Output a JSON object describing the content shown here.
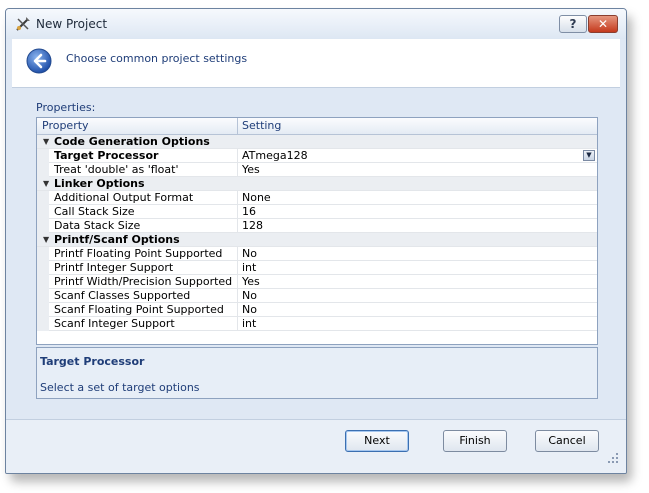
{
  "window": {
    "title": "New Project",
    "help_label": "?",
    "close_label": "✕"
  },
  "header": {
    "subtitle": "Choose common project settings"
  },
  "properties_label": "Properties:",
  "grid": {
    "columns": {
      "property": "Property",
      "setting": "Setting"
    },
    "categories": [
      {
        "label": "Code Generation Options",
        "rows": [
          {
            "name": "Target Processor",
            "value": "ATmega128"
          },
          {
            "name": "Treat 'double' as 'float'",
            "value": "Yes"
          }
        ]
      },
      {
        "label": "Linker Options",
        "rows": [
          {
            "name": "Additional Output Format",
            "value": "None"
          },
          {
            "name": "Call Stack Size",
            "value": "16"
          },
          {
            "name": "Data Stack Size",
            "value": "128"
          }
        ]
      },
      {
        "label": "Printf/Scanf Options",
        "rows": [
          {
            "name": "Printf Floating Point Supported",
            "value": "No"
          },
          {
            "name": "Printf Integer Support",
            "value": "int"
          },
          {
            "name": "Printf Width/Precision Supported",
            "value": "Yes"
          },
          {
            "name": "Scanf Classes Supported",
            "value": "No"
          },
          {
            "name": "Scanf Floating Point Supported",
            "value": "No"
          },
          {
            "name": "Scanf Integer Support",
            "value": "int"
          }
        ]
      }
    ]
  },
  "description": {
    "title": "Target Processor",
    "text": "Select a set of target options"
  },
  "buttons": {
    "next": "Next",
    "finish": "Finish",
    "cancel": "Cancel"
  },
  "colors": {
    "accent": "#1f3d78",
    "window_bg": "#dfe8f4",
    "close": "#c4391d"
  }
}
